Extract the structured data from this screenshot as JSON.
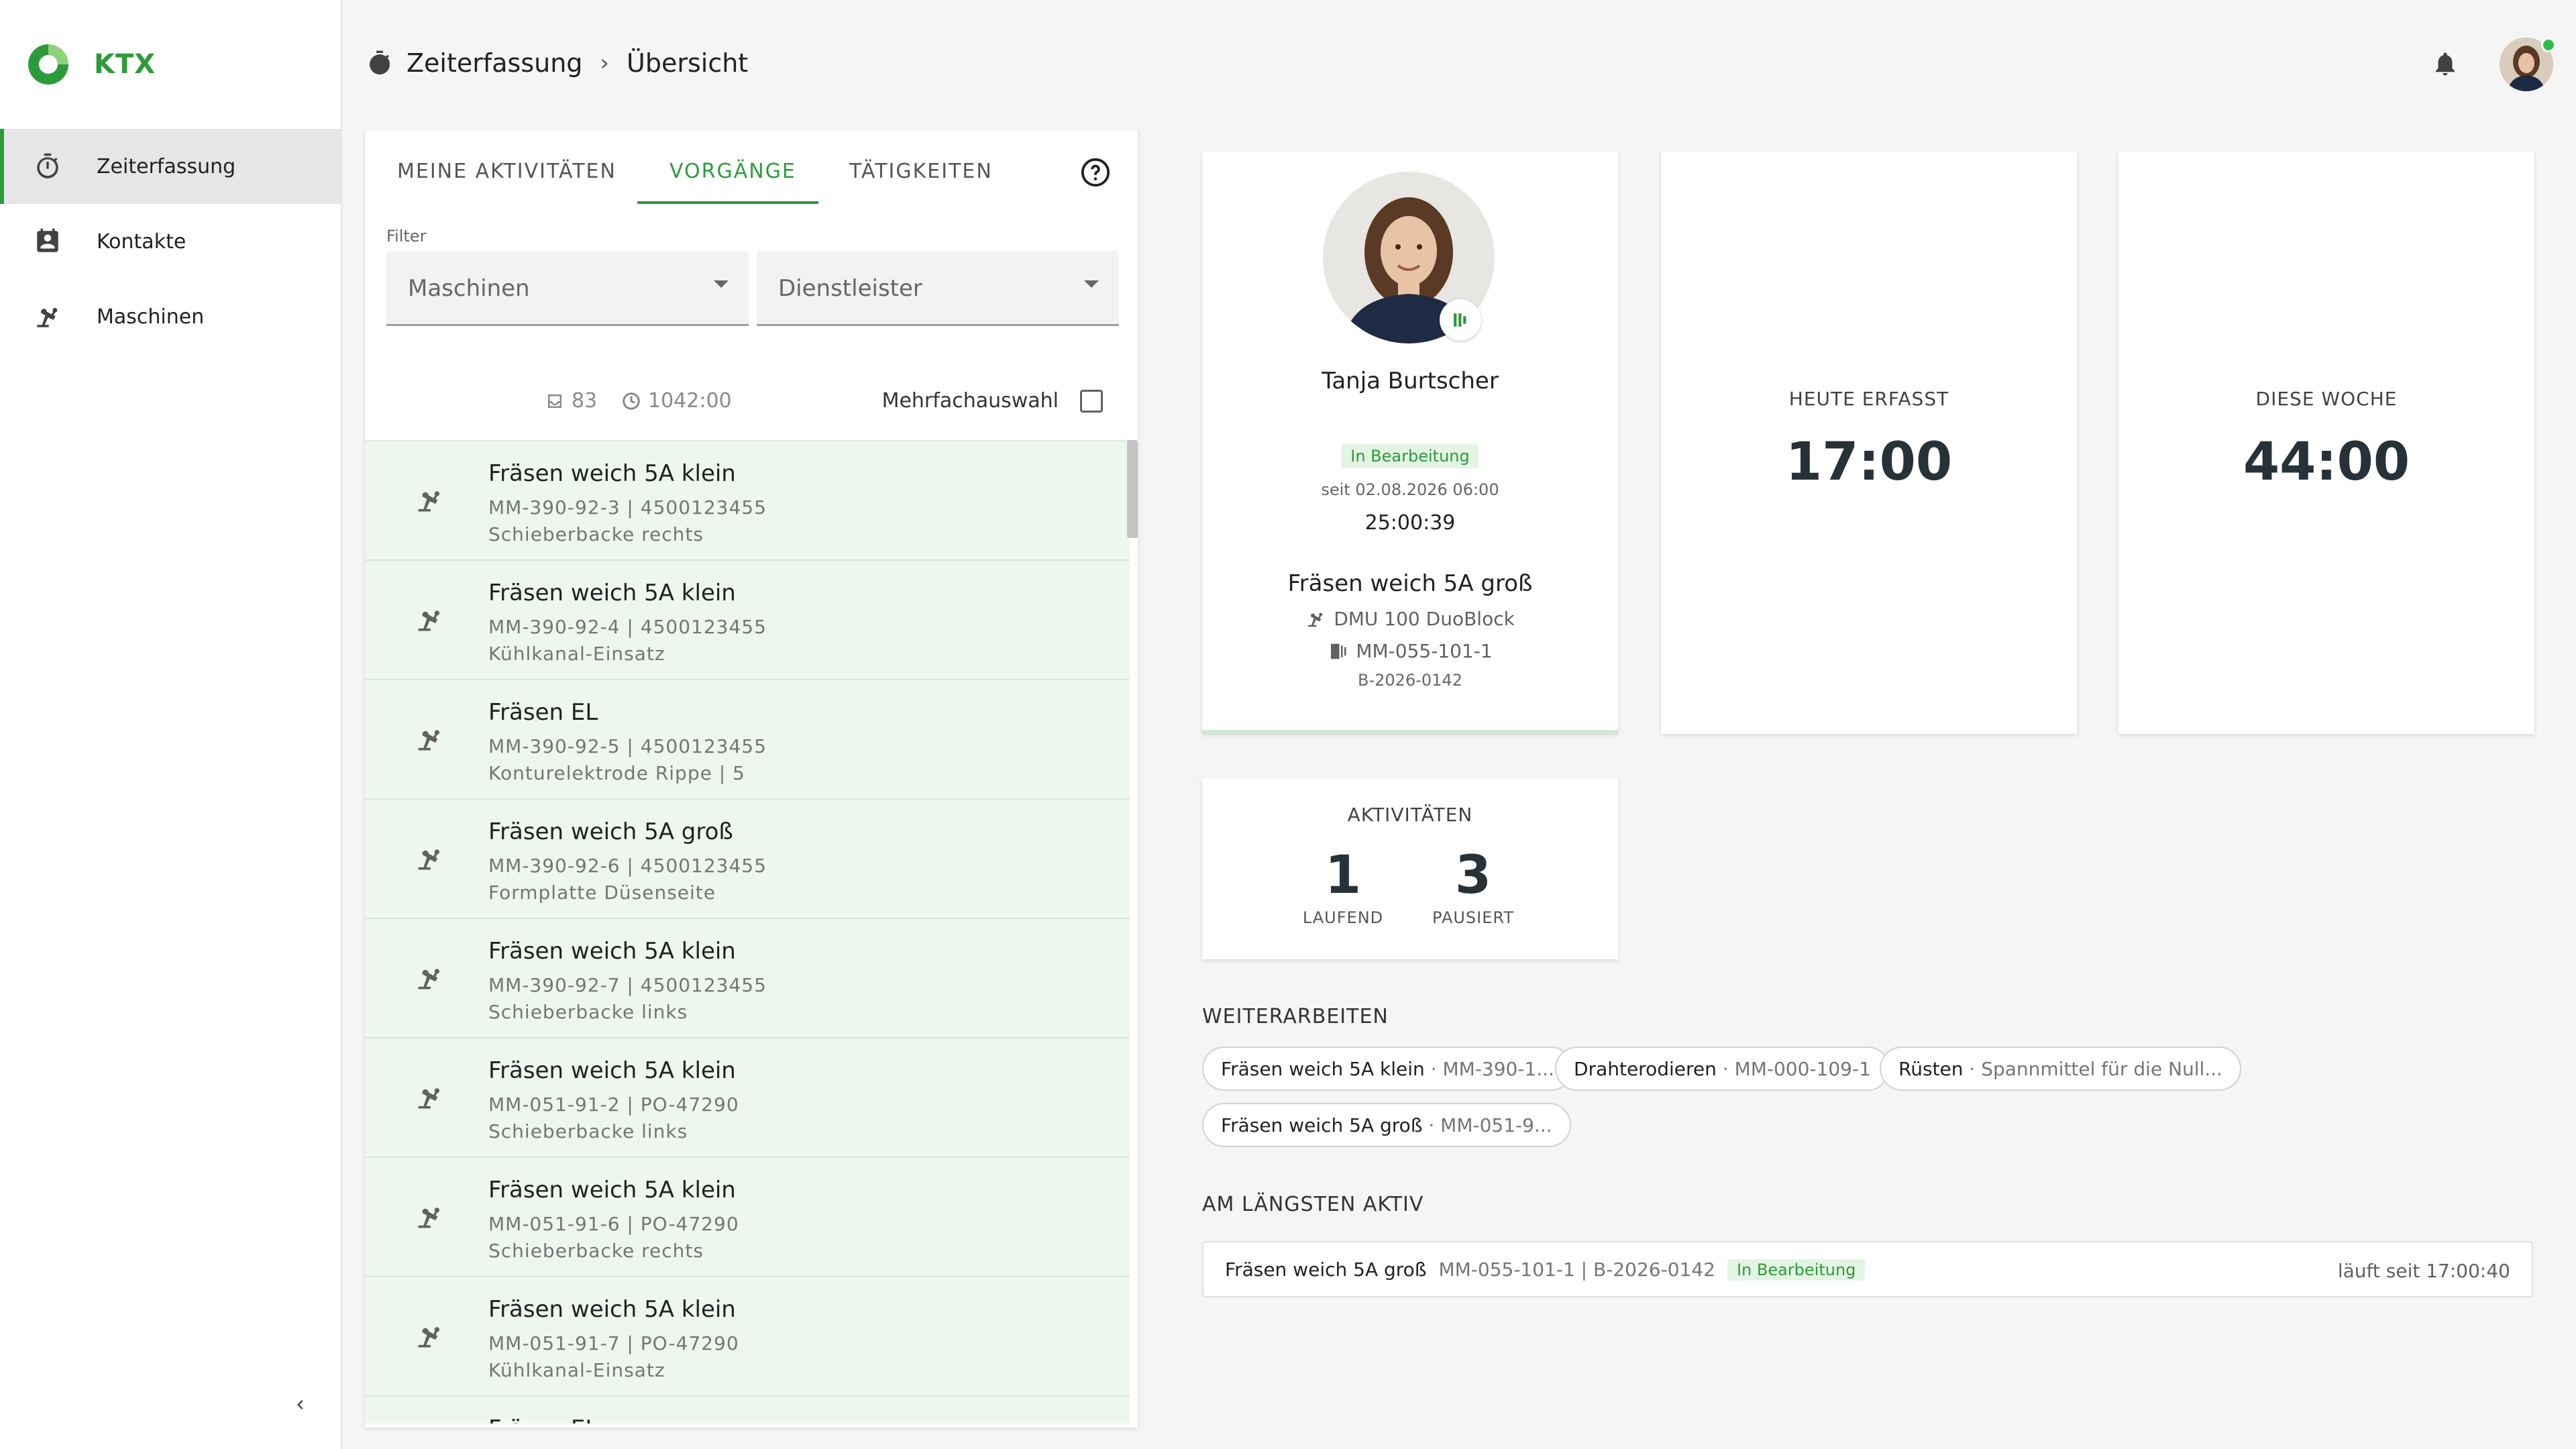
{
  "app": {
    "name": "KTX",
    "brand_color": "#2e9b3a"
  },
  "sidebar": {
    "items": [
      {
        "label": "Zeiterfassung",
        "icon": "stopwatch-icon",
        "active": true
      },
      {
        "label": "Kontakte",
        "icon": "contact-card-icon",
        "active": false
      },
      {
        "label": "Maschinen",
        "icon": "robot-arm-icon",
        "active": false
      }
    ],
    "collapse_icon": "chevron-left-icon"
  },
  "header": {
    "breadcrumb": [
      "Zeiterfassung",
      "Übersicht"
    ],
    "bell_icon": "bell-icon",
    "user_online": true
  },
  "panel": {
    "tabs": [
      {
        "label": "MEINE AKTIVITÄTEN",
        "active": false
      },
      {
        "label": "VORGÄNGE",
        "active": true
      },
      {
        "label": "TÄTIGKEITEN",
        "active": false
      }
    ],
    "filter_label": "Filter",
    "filters": [
      {
        "value": "Maschinen"
      },
      {
        "value": "Dienstleister"
      }
    ],
    "count": "83",
    "hours": "1042:00",
    "multiselect_label": "Mehrfachauswahl",
    "multiselect_checked": false,
    "rows": [
      {
        "title": "Fräsen weich 5A klein",
        "line2": "MM-390-92-3 | 4500123455",
        "line3": "Schieberbacke rechts"
      },
      {
        "title": "Fräsen weich 5A klein",
        "line2": "MM-390-92-4 | 4500123455",
        "line3": "Kühlkanal-Einsatz"
      },
      {
        "title": "Fräsen EL",
        "line2": "MM-390-92-5 | 4500123455",
        "line3": "Konturelektrode Rippe | 5"
      },
      {
        "title": "Fräsen weich 5A groß",
        "line2": "MM-390-92-6 | 4500123455",
        "line3": "Formplatte Düsenseite"
      },
      {
        "title": "Fräsen weich 5A klein",
        "line2": "MM-390-92-7 | 4500123455",
        "line3": "Schieberbacke links"
      },
      {
        "title": "Fräsen weich 5A klein",
        "line2": "MM-051-91-2 | PO-47290",
        "line3": "Schieberbacke links"
      },
      {
        "title": "Fräsen weich 5A klein",
        "line2": "MM-051-91-6 | PO-47290",
        "line3": "Schieberbacke rechts"
      },
      {
        "title": "Fräsen weich 5A klein",
        "line2": "MM-051-91-7 | PO-47290",
        "line3": "Kühlkanal-Einsatz"
      },
      {
        "title": "Fräsen EL",
        "line2": "",
        "line3": ""
      }
    ]
  },
  "active": {
    "name": "Tanja Burtscher",
    "status": "In Bearbeitung",
    "since": "seit 02.08.2026 06:00",
    "timer": "25:00:39",
    "task": "Fräsen weich 5A groß",
    "machine": "DMU 100 DuoBlock",
    "part": "MM-055-101-1",
    "order": "B-2026-0142"
  },
  "stats": {
    "today_label": "HEUTE ERFASST",
    "today_value": "17:00",
    "week_label": "DIESE WOCHE",
    "week_value": "44:00"
  },
  "activities": {
    "title": "AKTIVITÄTEN",
    "running": "1",
    "running_label": "LAUFEND",
    "paused": "3",
    "paused_label": "PAUSIERT"
  },
  "continue": {
    "title": "WEITERARBEITEN",
    "chips": [
      {
        "label": "Fräsen weich 5A klein",
        "detail": "· MM-390-1..."
      },
      {
        "label": "Drahterodieren",
        "detail": "· MM-000-109-1"
      },
      {
        "label": "Rüsten",
        "detail": "· Spannmittel für die Null..."
      },
      {
        "label": "Fräsen weich 5A groß",
        "detail": "· MM-051-9..."
      }
    ]
  },
  "longest": {
    "title": "AM LÄNGSTEN AKTIV",
    "task": "Fräsen weich 5A groß",
    "detail": "MM-055-101-1 | B-2026-0142",
    "status": "In Bearbeitung",
    "running": "läuft seit 17:00:40"
  }
}
